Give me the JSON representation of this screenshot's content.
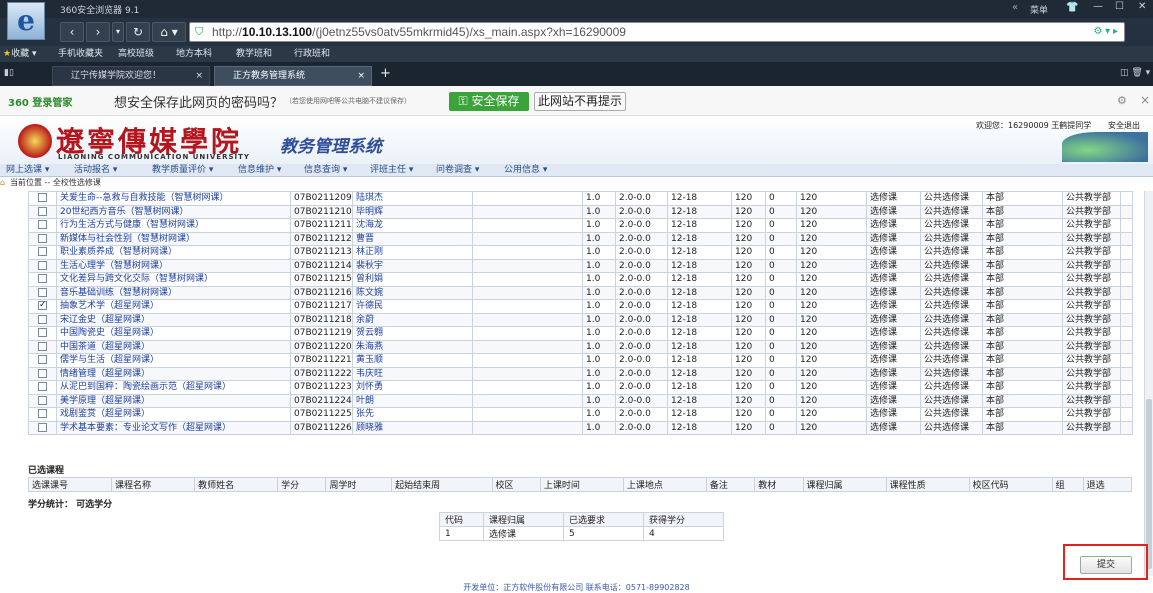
{
  "browser": {
    "title": "360安全浏览器 9.1",
    "url_prefix": "http://",
    "url_host": "10.10.13.100",
    "url_path": "/(j0etnz55vs0atv55mkrmid45)/xs_main.aspx?xh=16290009",
    "window_controls": [
      "菜单",
      "—",
      "☐",
      "✕"
    ],
    "favorites_label": "收藏",
    "favorites": [
      "手机收藏夹",
      "高校班级",
      "地方本科",
      "教学班和",
      "行政班和"
    ],
    "tabs": [
      "辽宁传媒学院欢迎您！",
      "正方教务管理系统"
    ],
    "save_prompt": {
      "brand": "360 登录管家",
      "question": "想安全保存此网页的密码吗？",
      "hint": "（若您使用网吧等公共电脑不建议保存）",
      "save_button": "安全保存",
      "never_button": "此网站不再提示"
    }
  },
  "header": {
    "school_name": "遼寧傳媒學院",
    "school_name_en": "LIAONING COMMUNICATION UNIVERSITY",
    "system_name": "教务管理系统",
    "welcome": "欢迎您：16290009 王鹤提同学",
    "logout": "安全退出"
  },
  "menu": [
    "网上选课 ▾",
    "活动报名 ▾",
    "教学质量评价 ▾",
    "信息维护 ▾",
    "信息查询 ▾",
    "评班主任 ▾",
    "问卷调查 ▾",
    "公用信息 ▾"
  ],
  "location": "当前位置 -- 全校性选修课",
  "courses": [
    {
      "checked": false,
      "name": "关爱生命--急救与自救技能（智慧树网课）",
      "code": "07B0211209",
      "teacher": "陆琪杰",
      "credit": "1.0",
      "hours": "2.0-0.0",
      "weeks": "12-18",
      "cap": "120",
      "enrolled": "0",
      "remain": "120",
      "type": "选修课",
      "nature": "公共选修课",
      "campus": "本部",
      "dept": "公共教学部"
    },
    {
      "checked": false,
      "name": "20世纪西方音乐（智慧树网课）",
      "code": "07B0211210",
      "teacher": "毕明辉",
      "credit": "1.0",
      "hours": "2.0-0.0",
      "weeks": "12-18",
      "cap": "120",
      "enrolled": "0",
      "remain": "120",
      "type": "选修课",
      "nature": "公共选修课",
      "campus": "本部",
      "dept": "公共教学部"
    },
    {
      "checked": false,
      "name": "行为生活方式与健康（智慧树网课）",
      "code": "07B0211211",
      "teacher": "沈海龙",
      "credit": "1.0",
      "hours": "2.0-0.0",
      "weeks": "12-18",
      "cap": "120",
      "enrolled": "0",
      "remain": "120",
      "type": "选修课",
      "nature": "公共选修课",
      "campus": "本部",
      "dept": "公共教学部"
    },
    {
      "checked": false,
      "name": "新媒体与社会性别（智慧树网课）",
      "code": "07B0211212",
      "teacher": "曹晋",
      "credit": "1.0",
      "hours": "2.0-0.0",
      "weeks": "12-18",
      "cap": "120",
      "enrolled": "0",
      "remain": "120",
      "type": "选修课",
      "nature": "公共选修课",
      "campus": "本部",
      "dept": "公共教学部"
    },
    {
      "checked": false,
      "name": "职业素质养成（智慧树网课）",
      "code": "07B0211213",
      "teacher": "林正刚",
      "credit": "1.0",
      "hours": "2.0-0.0",
      "weeks": "12-18",
      "cap": "120",
      "enrolled": "0",
      "remain": "120",
      "type": "选修课",
      "nature": "公共选修课",
      "campus": "本部",
      "dept": "公共教学部"
    },
    {
      "checked": false,
      "name": "生活心理学（智慧树网课）",
      "code": "07B0211214",
      "teacher": "裴秋宇",
      "credit": "1.0",
      "hours": "2.0-0.0",
      "weeks": "12-18",
      "cap": "120",
      "enrolled": "0",
      "remain": "120",
      "type": "选修课",
      "nature": "公共选修课",
      "campus": "本部",
      "dept": "公共教学部"
    },
    {
      "checked": false,
      "name": "文化差异与跨文化交际（智慧树网课）",
      "code": "07B0211215",
      "teacher": "曾利娟",
      "credit": "1.0",
      "hours": "2.0-0.0",
      "weeks": "12-18",
      "cap": "120",
      "enrolled": "0",
      "remain": "120",
      "type": "选修课",
      "nature": "公共选修课",
      "campus": "本部",
      "dept": "公共教学部"
    },
    {
      "checked": false,
      "name": "音乐基础训练（智慧树网课）",
      "code": "07B0211216",
      "teacher": "陈文婉",
      "credit": "1.0",
      "hours": "2.0-0.0",
      "weeks": "12-18",
      "cap": "120",
      "enrolled": "0",
      "remain": "120",
      "type": "选修课",
      "nature": "公共选修课",
      "campus": "本部",
      "dept": "公共教学部"
    },
    {
      "checked": true,
      "name": "抽象艺术学（超星网课）",
      "code": "07B0211217",
      "teacher": "许德民",
      "credit": "1.0",
      "hours": "2.0-0.0",
      "weeks": "12-18",
      "cap": "120",
      "enrolled": "0",
      "remain": "120",
      "type": "选修课",
      "nature": "公共选修课",
      "campus": "本部",
      "dept": "公共教学部"
    },
    {
      "checked": false,
      "name": "宋辽金史（超星网课）",
      "code": "07B0211218",
      "teacher": "余蔚",
      "credit": "1.0",
      "hours": "2.0-0.0",
      "weeks": "12-18",
      "cap": "120",
      "enrolled": "0",
      "remain": "120",
      "type": "选修课",
      "nature": "公共选修课",
      "campus": "本部",
      "dept": "公共教学部"
    },
    {
      "checked": false,
      "name": "中国陶瓷史（超星网课）",
      "code": "07B0211219",
      "teacher": "贺云翱",
      "credit": "1.0",
      "hours": "2.0-0.0",
      "weeks": "12-18",
      "cap": "120",
      "enrolled": "0",
      "remain": "120",
      "type": "选修课",
      "nature": "公共选修课",
      "campus": "本部",
      "dept": "公共教学部"
    },
    {
      "checked": false,
      "name": "中国茶道（超星网课）",
      "code": "07B0211220",
      "teacher": "朱海燕",
      "credit": "1.0",
      "hours": "2.0-0.0",
      "weeks": "12-18",
      "cap": "120",
      "enrolled": "0",
      "remain": "120",
      "type": "选修课",
      "nature": "公共选修课",
      "campus": "本部",
      "dept": "公共教学部"
    },
    {
      "checked": false,
      "name": "儒学与生活（超星网课）",
      "code": "07B0211221",
      "teacher": "黄玉顺",
      "credit": "1.0",
      "hours": "2.0-0.0",
      "weeks": "12-18",
      "cap": "120",
      "enrolled": "0",
      "remain": "120",
      "type": "选修课",
      "nature": "公共选修课",
      "campus": "本部",
      "dept": "公共教学部"
    },
    {
      "checked": false,
      "name": "情绪管理（超星网课）",
      "code": "07B0211222",
      "teacher": "韦庆旺",
      "credit": "1.0",
      "hours": "2.0-0.0",
      "weeks": "12-18",
      "cap": "120",
      "enrolled": "0",
      "remain": "120",
      "type": "选修课",
      "nature": "公共选修课",
      "campus": "本部",
      "dept": "公共教学部"
    },
    {
      "checked": false,
      "name": "从泥巴到国粹：陶瓷绘画示范（超星网课）",
      "code": "07B0211223",
      "teacher": "刘怀勇",
      "credit": "1.0",
      "hours": "2.0-0.0",
      "weeks": "12-18",
      "cap": "120",
      "enrolled": "0",
      "remain": "120",
      "type": "选修课",
      "nature": "公共选修课",
      "campus": "本部",
      "dept": "公共教学部"
    },
    {
      "checked": false,
      "name": "美学原理（超星网课）",
      "code": "07B0211224",
      "teacher": "叶朗",
      "credit": "1.0",
      "hours": "2.0-0.0",
      "weeks": "12-18",
      "cap": "120",
      "enrolled": "0",
      "remain": "120",
      "type": "选修课",
      "nature": "公共选修课",
      "campus": "本部",
      "dept": "公共教学部"
    },
    {
      "checked": false,
      "name": "戏剧鉴赏（超星网课）",
      "code": "07B0211225",
      "teacher": "张先",
      "credit": "1.0",
      "hours": "2.0-0.0",
      "weeks": "12-18",
      "cap": "120",
      "enrolled": "0",
      "remain": "120",
      "type": "选修课",
      "nature": "公共选修课",
      "campus": "本部",
      "dept": "公共教学部"
    },
    {
      "checked": false,
      "name": "学术基本要素：专业论文写作（超星网课）",
      "code": "07B0211226",
      "teacher": "顾晓雅",
      "credit": "1.0",
      "hours": "2.0-0.0",
      "weeks": "12-18",
      "cap": "120",
      "enrolled": "0",
      "remain": "120",
      "type": "选修课",
      "nature": "公共选修课",
      "campus": "本部",
      "dept": "公共教学部"
    }
  ],
  "selected": {
    "title": "已选课程",
    "headers": [
      "选课课号",
      "课程名称",
      "教师姓名",
      "学分",
      "周学时",
      "起始结束周",
      "校区",
      "上课时间",
      "上课地点",
      "备注",
      "教材",
      "课程归属",
      "课程性质",
      "校区代码",
      "组",
      "退选"
    ]
  },
  "credits": {
    "title": "学分统计： 可选学分",
    "headers": [
      "代码",
      "课程归属",
      "已选要求",
      "获得学分"
    ],
    "row": [
      "1",
      "选修课",
      "5",
      "4"
    ]
  },
  "submit_label": "提交",
  "footer": "开发单位：正方软件股份有限公司 联系电话：0571-89902828"
}
